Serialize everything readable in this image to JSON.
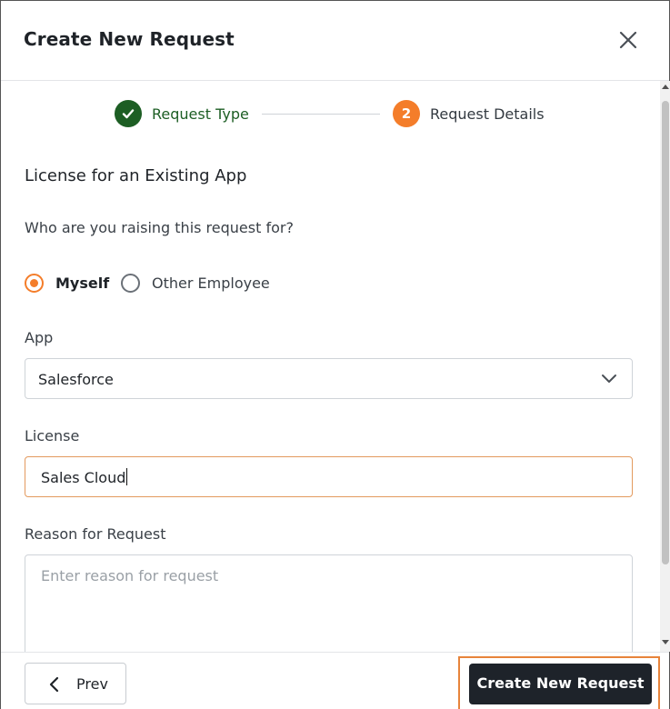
{
  "dialog": {
    "title": "Create New Request",
    "close_icon": "close-icon"
  },
  "stepper": {
    "steps": [
      {
        "label": "Request Type",
        "status": "completed",
        "icon": "check-icon"
      },
      {
        "label": "Request Details",
        "status": "active",
        "number": "2"
      }
    ],
    "colors": {
      "completed": "#1d5e24",
      "active": "#f47d2a"
    }
  },
  "form": {
    "section_title": "License for an Existing App",
    "question": "Who are you raising this request for?",
    "radio_options": [
      {
        "label": "Myself",
        "selected": true
      },
      {
        "label": "Other Employee",
        "selected": false
      }
    ],
    "app": {
      "label": "App",
      "value": "Salesforce",
      "icon": "chevron-down-icon"
    },
    "license": {
      "label": "License",
      "value": "Sales Cloud"
    },
    "reason": {
      "label": "Reason for Request",
      "placeholder": "Enter reason for request",
      "value": ""
    }
  },
  "footer": {
    "prev_label": "Prev",
    "prev_icon": "chevron-left-icon",
    "create_label": "Create New Request"
  },
  "colors": {
    "accent": "#f47d2a",
    "success": "#1d5e24",
    "primary_button": "#1e232a"
  }
}
